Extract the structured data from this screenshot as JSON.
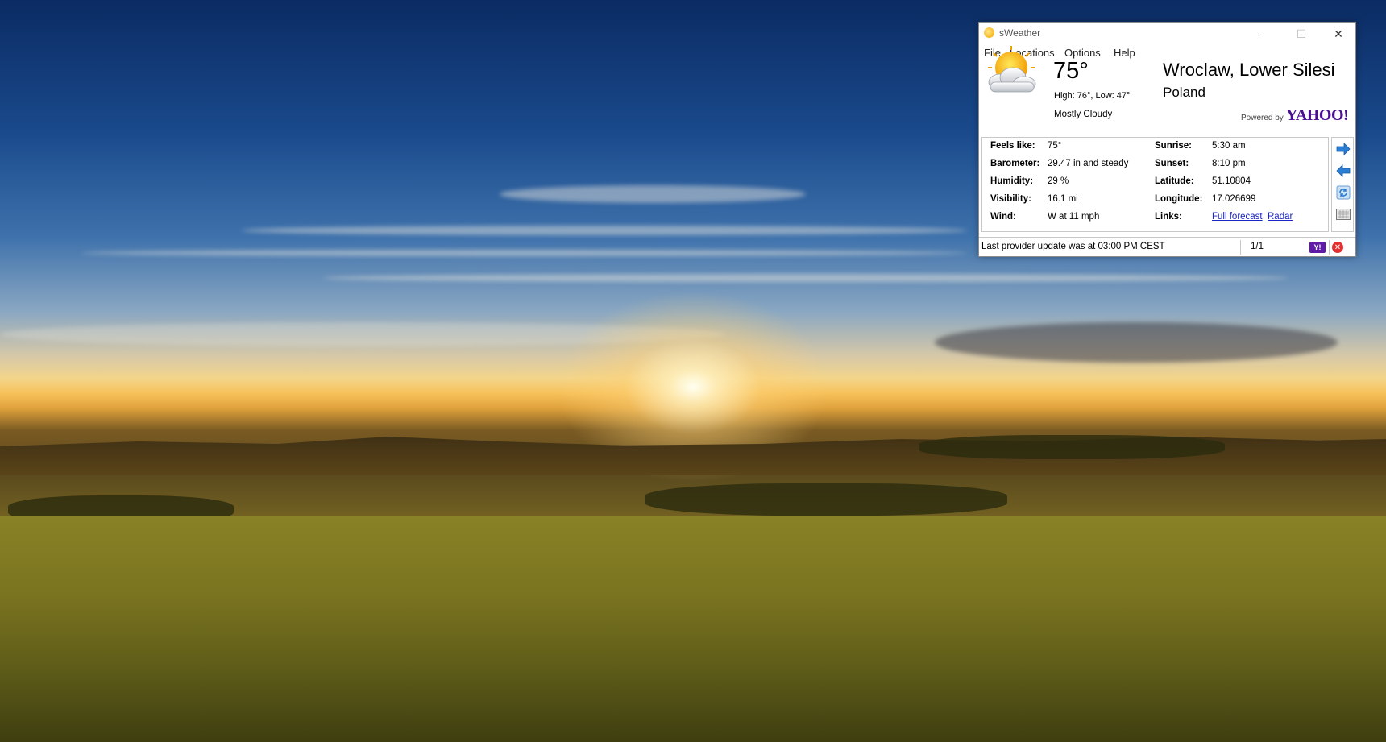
{
  "window": {
    "title": "sWeather",
    "controls": {
      "minimize": "—",
      "maximize": "☐",
      "close": "✕"
    }
  },
  "menu": {
    "items": [
      "File",
      "Locations",
      "Options",
      "Help"
    ]
  },
  "current": {
    "temperature": "75°",
    "high_low": "High: 76°, Low: 47°",
    "condition": "Mostly Cloudy",
    "icon": "partly-cloudy-sun-icon"
  },
  "location": {
    "city": "Wroclaw, Lower Silesi",
    "country": "Poland"
  },
  "provider": {
    "powered_by": "Powered by",
    "logo": "YAHOO!"
  },
  "details": {
    "left": [
      {
        "label": "Feels like:",
        "value": "75°"
      },
      {
        "label": "Barometer:",
        "value": "29.47 in and steady"
      },
      {
        "label": "Humidity:",
        "value": "29 %"
      },
      {
        "label": "Visibility:",
        "value": "16.1 mi"
      },
      {
        "label": "Wind:",
        "value": "W at 11 mph"
      }
    ],
    "right": [
      {
        "label": "Sunrise:",
        "value": "5:30 am"
      },
      {
        "label": "Sunset:",
        "value": "8:10 pm"
      },
      {
        "label": "Latitude:",
        "value": "51.10804"
      },
      {
        "label": "Longitude:",
        "value": "17.026699"
      }
    ],
    "links": {
      "label": "Links:",
      "full_forecast": "Full forecast",
      "radar": "Radar"
    }
  },
  "tools": [
    "next-arrow-icon",
    "back-arrow-icon",
    "refresh-icon",
    "keyboard-icon"
  ],
  "status": {
    "text": "Last provider update was at 03:00 PM CEST",
    "page": "1/1",
    "yahoo_badge": "Y!"
  },
  "colors": {
    "accent": "#1a24c8",
    "yahoo": "#4b0f93",
    "arrow": "#2a7fd4"
  }
}
